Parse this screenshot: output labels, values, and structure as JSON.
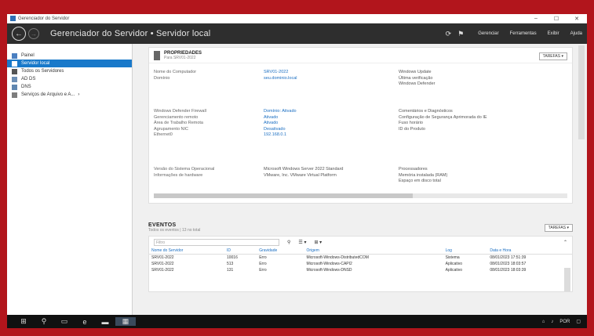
{
  "window": {
    "title": "Gerenciador do Servidor"
  },
  "header": {
    "breadcrumb": "Gerenciador do Servidor • Servidor local",
    "icons": [
      "refresh-icon",
      "notifications-flag-icon"
    ],
    "menu": [
      "Gerenciar",
      "Ferramentas",
      "Exibir",
      "Ajuda"
    ]
  },
  "sidebar": {
    "items": [
      {
        "label": "Painel",
        "icon": "dashboard-icon",
        "active": false
      },
      {
        "label": "Servidor local",
        "icon": "server-icon",
        "active": true
      },
      {
        "label": "Todos os Servidores",
        "icon": "servers-icon",
        "active": false
      },
      {
        "label": "AD DS",
        "icon": "ad-ds-icon",
        "active": false
      },
      {
        "label": "DNS",
        "icon": "dns-icon",
        "active": false
      },
      {
        "label": "Serviços de Arquivo e A...",
        "icon": "file-services-icon",
        "active": false
      }
    ]
  },
  "properties": {
    "server_name": "PROPRIEDADES",
    "server_sub": "Para SRV01-2022",
    "tasks_label": "TAREFAS",
    "group1": {
      "labels": [
        "Nome do Computador",
        "Domínio"
      ],
      "values": [
        "SRV01-2022",
        "seu.dominio.local"
      ],
      "right": [
        "Windows Update",
        "Última verificação",
        "Windows Defender"
      ]
    },
    "group2": {
      "labels": [
        "Windows Defender Firewall",
        "Gerenciamento remoto",
        "Área de Trabalho Remota",
        "Agrupamento NIC",
        "Ethernet0"
      ],
      "values": [
        "Domínio: Ativado",
        "Ativado",
        "Ativado",
        "Desativado",
        "192.168.0.1"
      ],
      "right": [
        "Comentários e Diagnósticos",
        "Configuração de Segurança Aprimorada do IE",
        "Fuso horário",
        "ID do Produto"
      ]
    },
    "group3": {
      "labels": [
        "Versão do Sistema Operacional",
        "Informações de hardware"
      ],
      "values": [
        "Microsoft Windows Server 2022 Standard",
        "VMware, Inc. VMware Virtual Platform"
      ],
      "right": [
        "Processadores",
        "Memória instalada (RAM)",
        "Espaço em disco total"
      ]
    }
  },
  "events": {
    "title": "EVENTOS",
    "subtitle": "Todos os eventos | 13 no total",
    "tasks_label": "TAREFAS",
    "filter_placeholder": "Filtro",
    "columns": [
      "Nome do Servidor",
      "ID",
      "Gravidade",
      "Origem",
      "Log",
      "Data e Hora"
    ],
    "rows": [
      [
        "SRV01-2022",
        "10016",
        "Erro",
        "Microsoft-Windows-DistributedCOM",
        "Sistema",
        "08/01/2023 17:51:39"
      ],
      [
        "SRV01-2022",
        "513",
        "Erro",
        "Microsoft-Windows-CAPI2",
        "Aplicativo",
        "08/01/2023 18:03:57"
      ],
      [
        "SRV01-2022",
        "131",
        "Erro",
        "Microsoft-Windows-DNSD",
        "Aplicativo",
        "08/01/2023 18:03:39"
      ]
    ]
  },
  "taskbar": {
    "icons": [
      "start-icon",
      "search-icon",
      "task-view-icon",
      "edge-icon",
      "file-explorer-icon",
      "server-manager-icon"
    ],
    "tray_text": "POR",
    "tray_icons": [
      "network-icon",
      "volume-icon",
      "notification-icon"
    ]
  },
  "colors": {
    "accent": "#1979ca",
    "header_bg": "#2e2e2e",
    "desktop": "#b2151c"
  }
}
